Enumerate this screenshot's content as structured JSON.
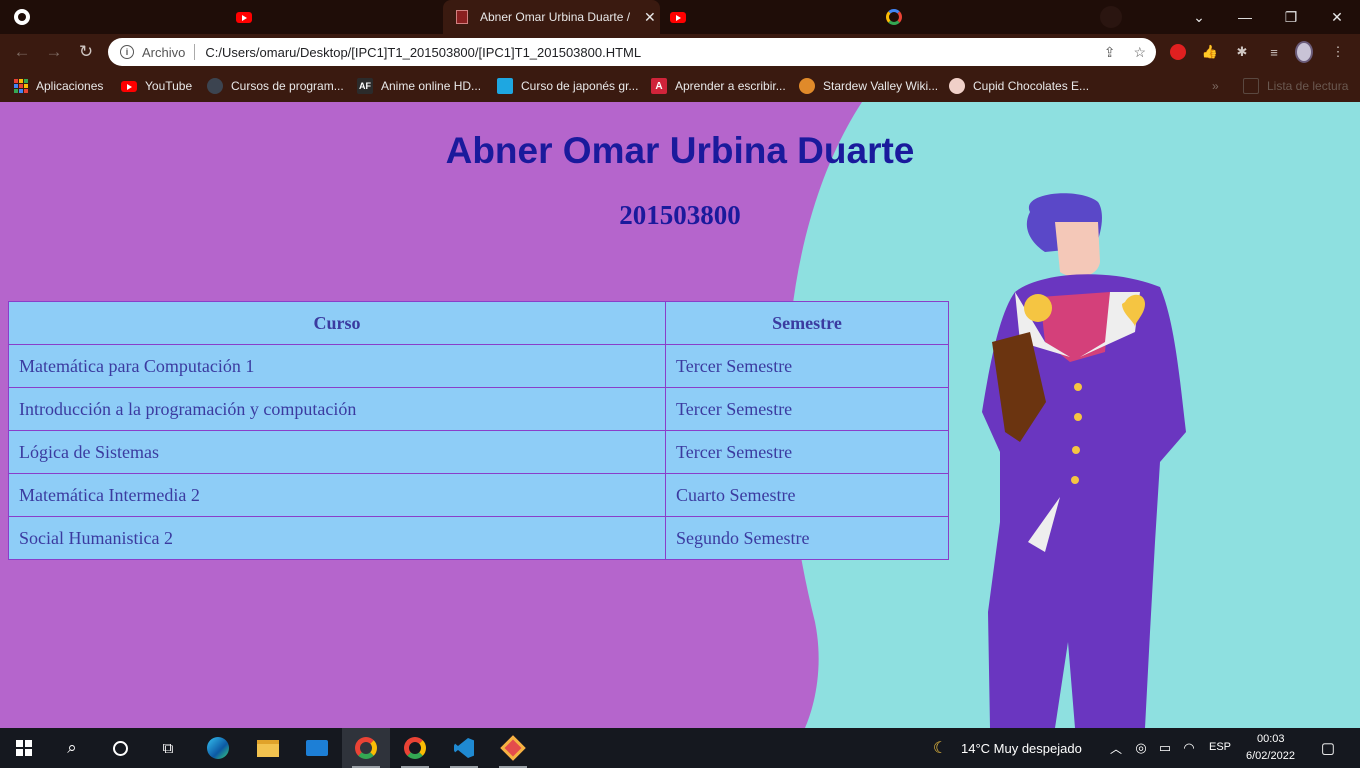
{
  "browser": {
    "tabs": [
      {
        "title": "",
        "icon": "github-icon"
      },
      {
        "title": "",
        "icon": "youtube-icon"
      },
      {
        "title": "Abner Omar Urbina Duarte /",
        "icon": "jojo-icon",
        "active": true
      },
      {
        "title": "",
        "icon": "youtube-icon"
      },
      {
        "title": "",
        "icon": "google-icon"
      }
    ],
    "address": {
      "scheme_label": "Archivo",
      "url": "C:/Users/omaru/Desktop/[IPC1]T1_201503800/[IPC1]T1_201503800.HTML"
    },
    "bookmarks": [
      {
        "label": "Aplicaciones",
        "icon": "apps-grid-icon"
      },
      {
        "label": "YouTube",
        "icon": "youtube-icon"
      },
      {
        "label": "Cursos de program...",
        "icon": "course-icon"
      },
      {
        "label": "Anime online HD...",
        "icon": "af-icon"
      },
      {
        "label": "Curso de japonés gr...",
        "icon": "chat-icon"
      },
      {
        "label": "Aprender a escribir...",
        "icon": "letter-icon"
      },
      {
        "label": "Stardew Valley Wiki...",
        "icon": "chicken-icon"
      },
      {
        "label": "Cupid Chocolates E...",
        "icon": "cupid-icon"
      }
    ],
    "reading_list": "Lista de lectura"
  },
  "page": {
    "title": "Abner Omar Urbina Duarte",
    "student_id": "201503800",
    "table": {
      "headers": [
        "Curso",
        "Semestre"
      ],
      "rows": [
        {
          "curso": "Matemática para Computación 1",
          "semestre": "Tercer Semestre"
        },
        {
          "curso": "Introducción a la programación y computación",
          "semestre": "Tercer Semestre"
        },
        {
          "curso": "Lógica de Sistemas",
          "semestre": "Tercer Semestre"
        },
        {
          "curso": "Matemática Intermedia 2",
          "semestre": "Cuarto Semestre"
        },
        {
          "curso": "Social Humanistica 2",
          "semestre": "Segundo Semestre"
        }
      ]
    }
  },
  "taskbar": {
    "weather": "14°C  Muy despejado",
    "lang": "ESP",
    "time": "00:03",
    "date": "6/02/2022"
  },
  "colors": {
    "page_bg": "#b565cc",
    "wave": "#8ee0e0",
    "heading": "#1a1a9c",
    "table_bg": "#8ecdf7",
    "table_border": "#8a3ec9"
  }
}
